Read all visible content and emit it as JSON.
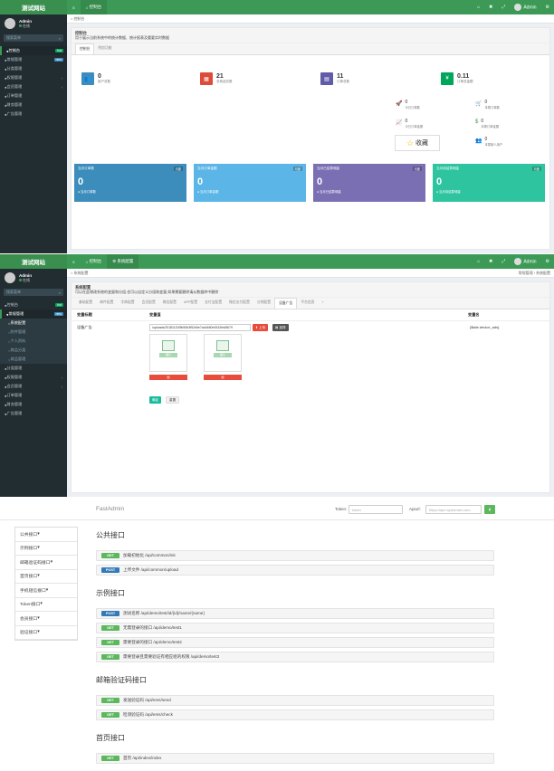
{
  "app": {
    "brand": "测试网站",
    "user_name": "Admin",
    "user_status": "在线",
    "search_placeholder": "搜索菜单",
    "topbar_user": "Admin"
  },
  "dashboard": {
    "tab_label": "控制台",
    "breadcrumb": "控制台",
    "header_title": "控制台",
    "header_desc": "用于展示当前系统中的统计数据、统计报表及重要实时数据",
    "tabs": [
      "控制台",
      "附加功能"
    ],
    "menu": [
      {
        "label": "控制台",
        "badge": "hot",
        "badge_color": "#00a65a"
      },
      {
        "label": "常规管理",
        "badge": "new",
        "badge_color": "#3c8dbc"
      },
      {
        "label": "分类管理"
      },
      {
        "label": "权限管理",
        "chev": true
      },
      {
        "label": "会员管理",
        "chev": true
      },
      {
        "label": "订单管理"
      },
      {
        "label": "财务管理"
      },
      {
        "label": "广告管理"
      }
    ],
    "stats": [
      {
        "value": "0",
        "label": "用户总数",
        "color": "#3c8dbc",
        "icon": "users-icon",
        "glyph": "👥"
      },
      {
        "value": "21",
        "label": "总商品总数",
        "color": "#dd4b39",
        "icon": "cart-icon",
        "glyph": "▦"
      },
      {
        "value": "11",
        "label": "订单总数",
        "color": "#605ca8",
        "icon": "book-icon",
        "glyph": "▤"
      },
      {
        "value": "0.11",
        "label": "订单总金额",
        "color": "#00a65a",
        "icon": "yen-icon",
        "glyph": "¥"
      }
    ],
    "mini": [
      {
        "value": "0",
        "label": "今日订单数",
        "icon": "rocket-icon",
        "glyph": "🚀",
        "color": "#3c9a56"
      },
      {
        "value": "0",
        "label": "本周订单数",
        "icon": "cart-small-icon",
        "glyph": "🛒",
        "color": "#3c9a56"
      },
      {
        "value": "0",
        "label": "今日订单金额",
        "icon": "chart-line-icon",
        "glyph": "📈",
        "color": "#3c9a56"
      },
      {
        "value": "0",
        "label": "本周订单金额",
        "icon": "dollar-icon",
        "glyph": "$",
        "color": "#3c9a56"
      },
      {
        "value": "0",
        "label": "本周新人用户",
        "icon": "group-icon",
        "glyph": "👥",
        "color": "#3c9a56"
      }
    ],
    "favorite": "收藏",
    "boxes": [
      {
        "title": "当月订单数",
        "badge": "月度",
        "value": "0",
        "foot": "当月订单数",
        "color": "#3c8dbc"
      },
      {
        "title": "当月订单金额",
        "badge": "月度",
        "value": "0",
        "foot": "当月订单金额",
        "color": "#5bb5e6"
      },
      {
        "title": "当月已结算佣金",
        "badge": "月度",
        "value": "0",
        "foot": "当月已结算佣金",
        "color": "#7a6fb3"
      },
      {
        "title": "当月待结算佣金",
        "badge": "月度",
        "value": "0",
        "foot": "当月待结算佣金",
        "color": "#2ec4a0"
      }
    ]
  },
  "settings": {
    "tab_label": "系统配置",
    "breadcrumb": "系统配置",
    "bread_right": [
      "常规管理",
      "系统配置"
    ],
    "header_title": "系统配置",
    "header_desc": "可以在此增改系统的变量和分组,也可以自定义分组和变量,如果需要删除请从数据库中删除",
    "tabs": [
      "基础配置",
      "邮件配置",
      "字典配置",
      "会员配置",
      "微信配置",
      "APP配置",
      "支付宝配置",
      "微信支付配置",
      "分销配置",
      "设备广告",
      "平台信息",
      "+"
    ],
    "active_tab": 9,
    "menu": [
      {
        "label": "控制台",
        "badge": "hot",
        "badge_color": "#00a65a"
      },
      {
        "label": "常规管理",
        "badge": "new",
        "badge_color": "#3c8dbc"
      },
      {
        "label": "系统配置",
        "sub": true,
        "act": true
      },
      {
        "label": "附件管理",
        "sub": true
      },
      {
        "label": "个人资料",
        "sub": true
      },
      {
        "label": "商品分类",
        "sub": true
      },
      {
        "label": "商品管理",
        "sub": true
      },
      {
        "label": "分类管理"
      },
      {
        "label": "权限管理",
        "chev": true
      },
      {
        "label": "会员管理",
        "chev": true
      },
      {
        "label": "订单管理"
      },
      {
        "label": "财务管理"
      },
      {
        "label": "广告管理"
      }
    ],
    "col_title": "变量标题",
    "col_value": "变量值",
    "col_name": "变量名",
    "row_title": "设备广告",
    "row_path": "/uploads/20181120/5b50b3f52d0e7ad4460e9242fed5679",
    "upload_btn": "上传",
    "choose_btn": "选择",
    "row_name": "{$site.device_ads}",
    "thumb_label": "图片",
    "del_label": "删",
    "submit_btn": "确定",
    "reset_btn": "重置"
  },
  "api": {
    "brand": "FastAdmin",
    "token_label": "Token:",
    "token_placeholder": "token",
    "apiurl_label": "Apiurl:",
    "apiurl_placeholder": "https://api.mydomain.com",
    "side": [
      "公共接口",
      "示例接口",
      "邮箱验证码接口",
      "首页接口",
      "手机短信接口",
      "Token接口",
      "会员接口",
      "验证接口"
    ],
    "sections": [
      {
        "title": "公共接口",
        "items": [
          {
            "method": "GET",
            "text": "加载初始化 /api/common/init"
          },
          {
            "method": "POST",
            "text": "上传文件 /api/common/upload"
          }
        ]
      },
      {
        "title": "示例接口",
        "items": [
          {
            "method": "POST",
            "text": "测试名称 /api/demo/test/id/{id}/name/{name}"
          },
          {
            "method": "GET",
            "text": "无需登录的接口 /api/demo/test1"
          },
          {
            "method": "GET",
            "text": "需要登录的接口 /api/demo/test2"
          },
          {
            "method": "GET",
            "text": "需要登录且需要验证有相应组的权限 /api/demo/test3"
          }
        ]
      },
      {
        "title": "邮箱验证码接口",
        "items": [
          {
            "method": "GET",
            "text": "发送验证码 /api/ems/send"
          },
          {
            "method": "GET",
            "text": "检测验证码 /api/ems/check"
          }
        ]
      },
      {
        "title": "首页接口",
        "items": [
          {
            "method": "GET",
            "text": "首页 /api/index/index"
          }
        ]
      }
    ]
  }
}
